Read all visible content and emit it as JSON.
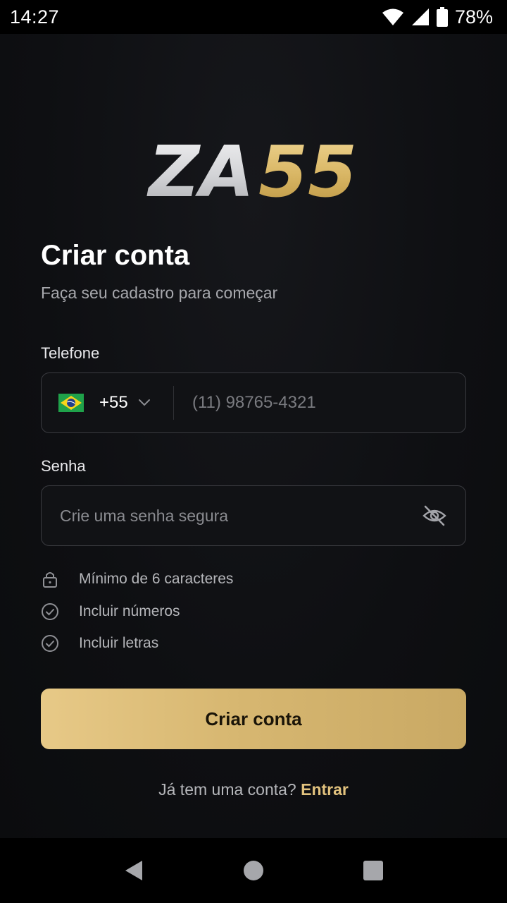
{
  "status_bar": {
    "time": "14:27",
    "battery": "78%",
    "icons": [
      "wifi-icon",
      "signal-icon",
      "battery-icon"
    ]
  },
  "brand": {
    "logo_left": "ZA",
    "logo_right": "55",
    "colors": {
      "silver": "#d9dadc",
      "gold": "#d8b563"
    }
  },
  "header": {
    "title": "Criar conta",
    "subtitle": "Faça seu cadastro para começar"
  },
  "phone": {
    "label": "Telefone",
    "country_code": "+55",
    "country_flag": "brazil-flag-icon",
    "placeholder": "(11) 98765-4321",
    "value": ""
  },
  "password": {
    "label": "Senha",
    "placeholder": "Crie uma senha segura",
    "value": "",
    "toggle_icon": "eye-off-icon"
  },
  "requirements": [
    {
      "text": "Mínimo de 6 caracteres",
      "icon": "lock-icon"
    },
    {
      "text": "Incluir números",
      "icon": "check-circle-icon"
    },
    {
      "text": "Incluir letras",
      "icon": "check-circle-icon"
    }
  ],
  "submit": {
    "label": "Criar conta",
    "color": "#d7b771"
  },
  "signin": {
    "prompt": "Já tem uma conta?",
    "link": "Entrar",
    "link_color": "#e2c27e"
  },
  "nav": [
    "back-icon",
    "home-icon",
    "recents-icon"
  ]
}
